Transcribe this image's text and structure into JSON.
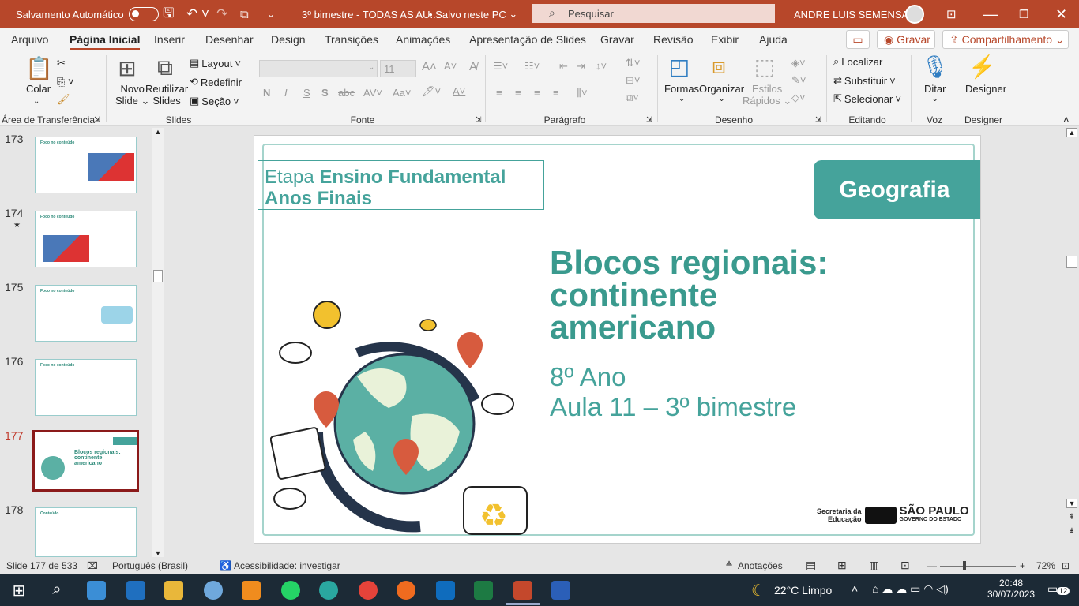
{
  "titlebar": {
    "autosave_label": "Salvamento Automático",
    "doc_title": "3º bimestre - TODAS AS AU...",
    "save_status": "• Salvo neste PC",
    "search_placeholder": "Pesquisar",
    "user_name": "ANDRE LUIS SEMENSATO"
  },
  "menu": {
    "tabs": [
      "Arquivo",
      "Página Inicial",
      "Inserir",
      "Desenhar",
      "Design",
      "Transições",
      "Animações",
      "Apresentação de Slides",
      "Gravar",
      "Revisão",
      "Exibir",
      "Ajuda"
    ],
    "record_label": "Gravar",
    "share_label": "Compartilhamento"
  },
  "ribbon": {
    "groups": {
      "clipboard": "Área de Transferência",
      "slides": "Slides",
      "font": "Fonte",
      "paragraph": "Parágrafo",
      "drawing": "Desenho",
      "editing": "Editando",
      "voice": "Voz",
      "designer": "Designer"
    },
    "paste": "Colar",
    "new_slide": [
      "Novo",
      "Slide"
    ],
    "reuse_slides": [
      "Reutilizar",
      "Slides"
    ],
    "layout": "Layout",
    "reset": "Redefinir",
    "section": "Seção",
    "font_size": "11",
    "shapes": "Formas",
    "arrange": "Organizar",
    "quick_styles": [
      "Estilos",
      "Rápidos"
    ],
    "find": "Localizar",
    "replace": "Substituir",
    "select": "Selecionar",
    "dictate": "Ditar",
    "designer": "Designer"
  },
  "thumbnails": [
    {
      "num": "173",
      "title": "Foco no conteúdo"
    },
    {
      "num": "174",
      "title": "Foco no conteúdo",
      "star": "★"
    },
    {
      "num": "175",
      "title": "Foco no conteúdo"
    },
    {
      "num": "176",
      "title": "Foco no conteúdo"
    },
    {
      "num": "177",
      "title": "Blocos regionais: continente americano"
    },
    {
      "num": "178",
      "title": "Conteúdo"
    }
  ],
  "slide": {
    "etapa_prefix": "Etapa ",
    "etapa_bold1": "Ensino Fundamental",
    "etapa_bold2": "Anos Finais",
    "subject": "Geografia",
    "title_lines": [
      "Blocos regionais:",
      "continente",
      "americano"
    ],
    "grade": "8º Ano",
    "lesson": "Aula 11 – 3º bimestre",
    "logo_left": [
      "Secretaria da",
      "Educação"
    ],
    "logo_right": [
      "SÃO PAULO",
      "GOVERNO DO ESTADO"
    ]
  },
  "status": {
    "slide_count": "Slide 177 de 533",
    "language": "Português (Brasil)",
    "accessibility": "Acessibilidade: investigar",
    "notes": "Anotações",
    "zoom": "72%"
  },
  "taskbar": {
    "weather": "22°C  Limpo",
    "time": "20:48",
    "date": "30/07/2023",
    "notifications": "12"
  },
  "colors": {
    "accent": "#b7472a",
    "teal": "#45a39b"
  }
}
